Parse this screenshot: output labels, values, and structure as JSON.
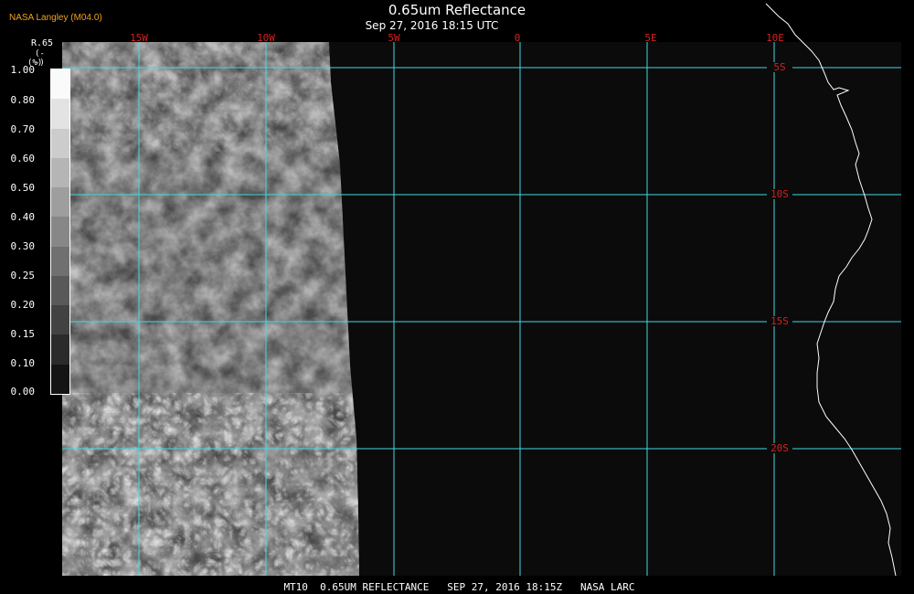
{
  "header": {
    "org": "NASA Langley (M04.0)",
    "title": "0.65um Reflectance",
    "time": "Sep 27, 2016 18:15 UTC"
  },
  "colorbar": {
    "title": "R.65",
    "unit": "(--)",
    "unit_prefix": "(%)",
    "ticks": [
      "1.00",
      "0.80",
      "0.70",
      "0.60",
      "0.50",
      "0.40",
      "0.30",
      "0.25",
      "0.20",
      "0.15",
      "0.10",
      "0.00"
    ]
  },
  "grid": {
    "line_color": "#40d8e0",
    "label_color": "#d42020",
    "lon_labels": [
      "15W",
      "10W",
      "5W",
      "0",
      "5E",
      "10E"
    ],
    "lat_labels": [
      "5S",
      "10S",
      "15S",
      "20S"
    ]
  },
  "footer": "MT10  0.65UM REFLECTANCE   SEP 27, 2016 18:15Z   NASA LARC"
}
